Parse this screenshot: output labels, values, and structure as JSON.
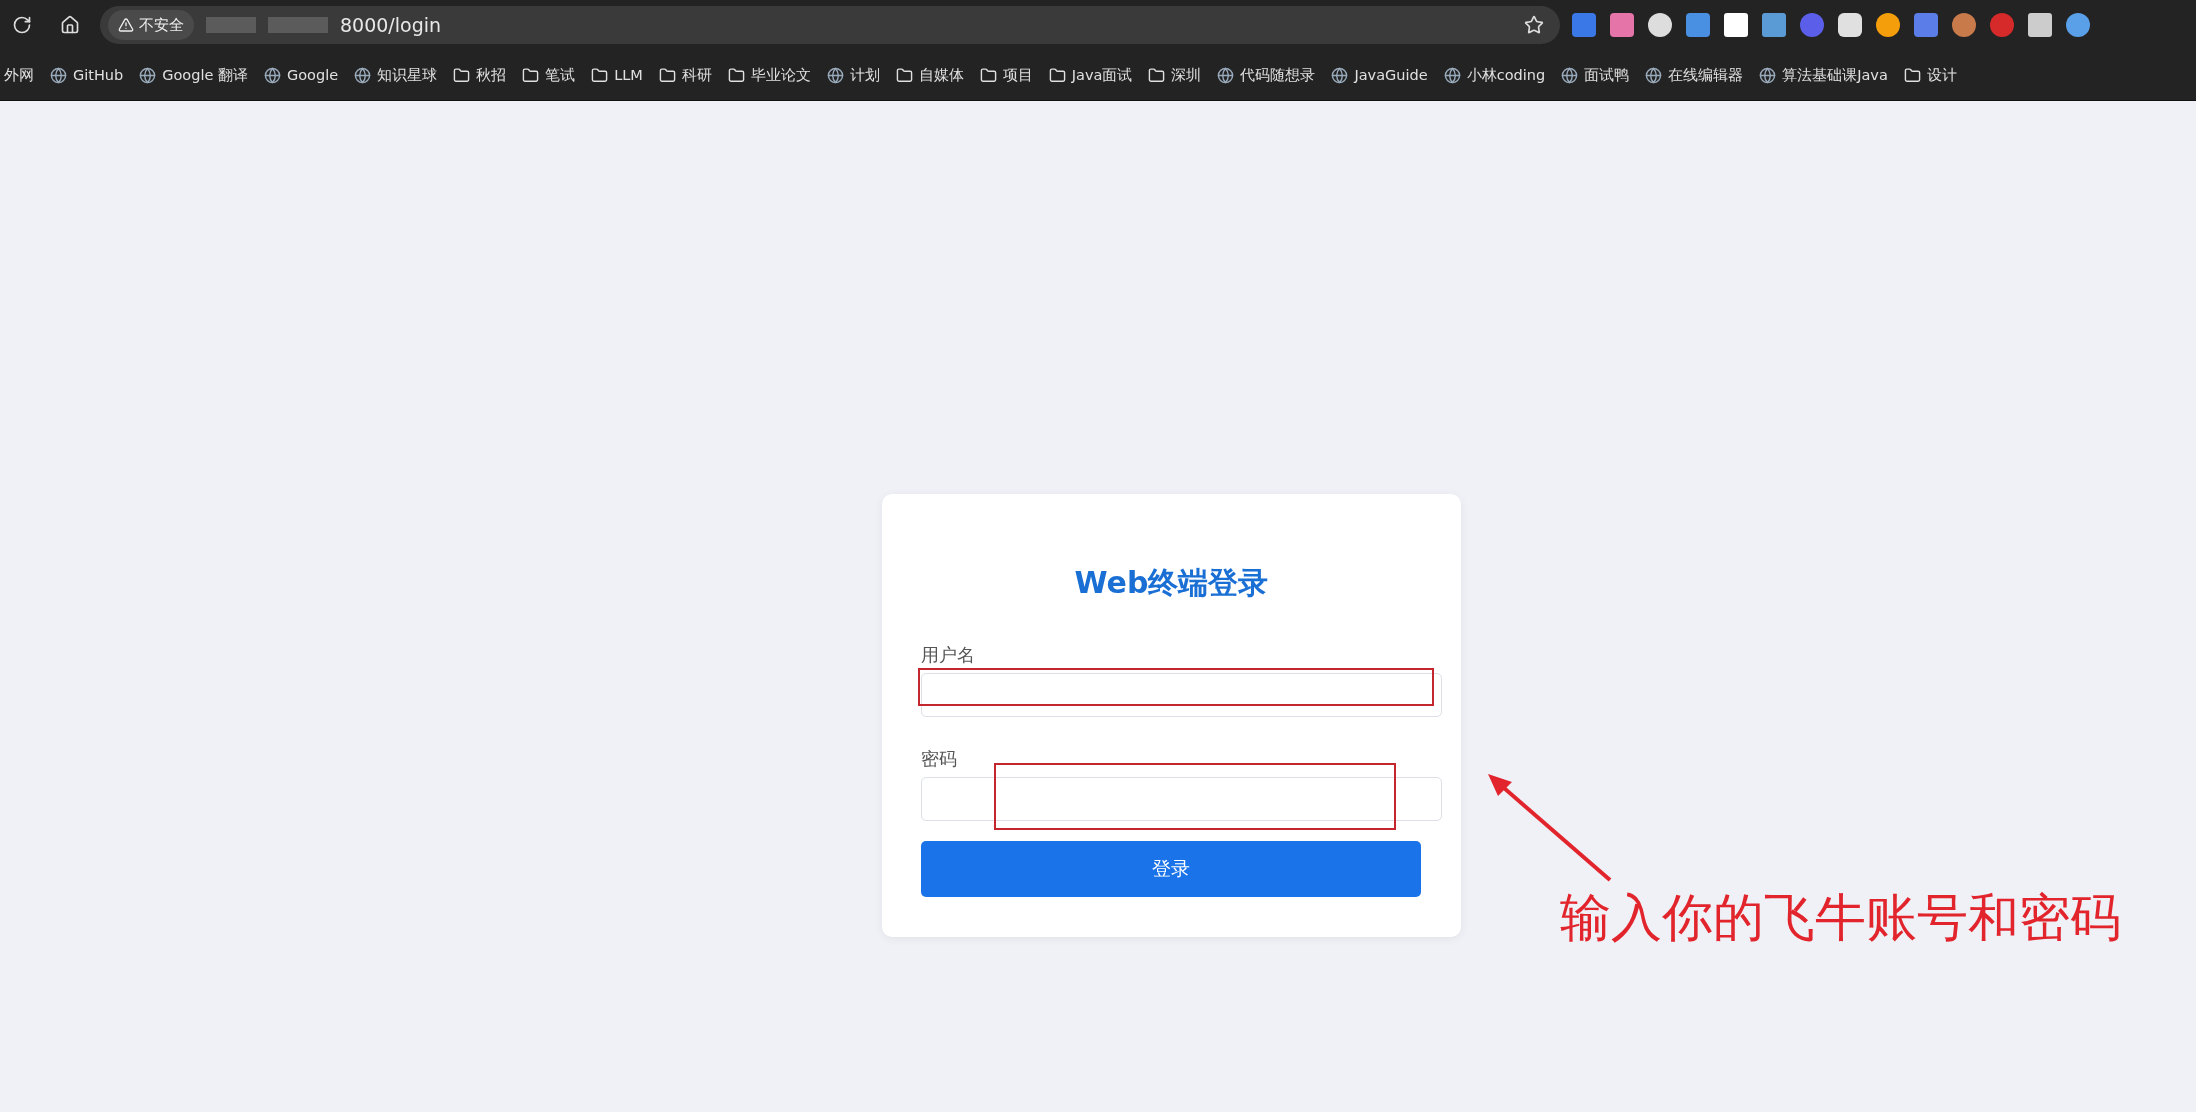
{
  "browser": {
    "security_label": "不安全",
    "url": "8000/login",
    "bookmarks": [
      {
        "label": "外网",
        "kind": "plain"
      },
      {
        "label": "GitHub",
        "kind": "site"
      },
      {
        "label": "Google 翻译",
        "kind": "site"
      },
      {
        "label": "Google",
        "kind": "site"
      },
      {
        "label": "知识星球",
        "kind": "site"
      },
      {
        "label": "秋招",
        "kind": "folder"
      },
      {
        "label": "笔试",
        "kind": "folder"
      },
      {
        "label": "LLM",
        "kind": "folder"
      },
      {
        "label": "科研",
        "kind": "folder"
      },
      {
        "label": "毕业论文",
        "kind": "folder"
      },
      {
        "label": "计划",
        "kind": "site"
      },
      {
        "label": "自媒体",
        "kind": "folder"
      },
      {
        "label": "项目",
        "kind": "folder"
      },
      {
        "label": "Java面试",
        "kind": "folder"
      },
      {
        "label": "深圳",
        "kind": "folder"
      },
      {
        "label": "代码随想录",
        "kind": "site"
      },
      {
        "label": "JavaGuide",
        "kind": "site"
      },
      {
        "label": "小林coding",
        "kind": "site"
      },
      {
        "label": "面试鸭",
        "kind": "site"
      },
      {
        "label": "在线编辑器",
        "kind": "site"
      },
      {
        "label": "算法基础课Java",
        "kind": "site"
      },
      {
        "label": "设计",
        "kind": "folder"
      }
    ]
  },
  "login": {
    "title": "Web终端登录",
    "fields": [
      {
        "label": "用户名"
      },
      {
        "label": "密码"
      }
    ],
    "submit": "登录"
  },
  "annotation": {
    "callout": "输入你的飞牛账号和密码"
  }
}
